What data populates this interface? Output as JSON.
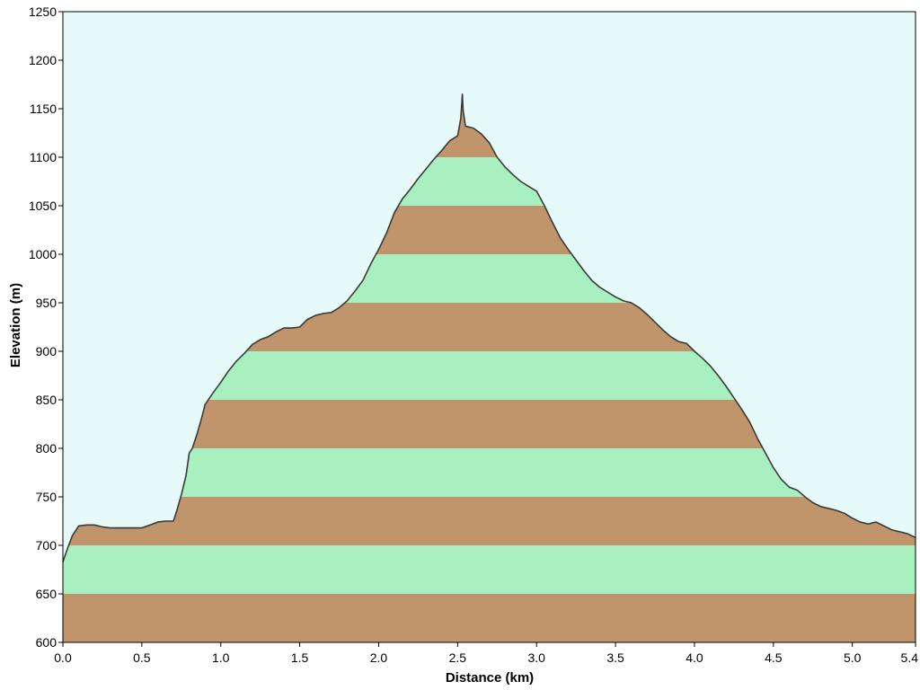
{
  "chart_data": {
    "type": "area",
    "title": "",
    "xlabel": "Distance   (km)",
    "ylabel": "Elevation (m)",
    "xlim": [
      0,
      5.4
    ],
    "ylim": [
      600,
      1250
    ],
    "grid": false,
    "legend": "none",
    "x_ticks": [
      "0.0",
      "0.5",
      "1.0",
      "1.5",
      "2.0",
      "2.5",
      "3.0",
      "3.5",
      "4.0",
      "4.5",
      "5.0",
      "5.4"
    ],
    "y_ticks": [
      "600",
      "650",
      "700",
      "750",
      "800",
      "850",
      "900",
      "950",
      "1000",
      "1050",
      "1100",
      "1150",
      "1200",
      "1250"
    ],
    "band_interval": 50,
    "colors": {
      "sky": "#e6fafa",
      "band_a": "#c1956b",
      "band_b": "#a8f0c0",
      "outline": "#3a3a3a"
    },
    "series": [
      {
        "x": [
          0.0,
          0.03,
          0.06,
          0.1,
          0.15,
          0.2,
          0.25,
          0.3,
          0.4,
          0.5,
          0.57,
          0.6,
          0.65,
          0.7,
          0.72,
          0.75,
          0.78,
          0.8,
          0.82,
          0.85,
          0.88,
          0.9,
          0.95,
          1.0,
          1.05,
          1.1,
          1.15,
          1.2,
          1.25,
          1.3,
          1.35,
          1.4,
          1.45,
          1.5,
          1.55,
          1.6,
          1.65,
          1.7,
          1.75,
          1.8,
          1.85,
          1.9,
          1.95,
          2.0,
          2.05,
          2.1,
          2.15,
          2.2,
          2.25,
          2.3,
          2.35,
          2.4,
          2.45,
          2.5,
          2.52,
          2.53,
          2.535,
          2.55,
          2.6,
          2.65,
          2.7,
          2.75,
          2.8,
          2.85,
          2.9,
          2.95,
          3.0,
          3.05,
          3.1,
          3.15,
          3.2,
          3.25,
          3.3,
          3.35,
          3.4,
          3.45,
          3.5,
          3.55,
          3.6,
          3.65,
          3.7,
          3.75,
          3.8,
          3.85,
          3.9,
          3.95,
          4.0,
          4.05,
          4.1,
          4.15,
          4.2,
          4.25,
          4.3,
          4.35,
          4.4,
          4.45,
          4.5,
          4.55,
          4.6,
          4.65,
          4.7,
          4.75,
          4.8,
          4.85,
          4.9,
          4.95,
          5.0,
          5.05,
          5.1,
          5.15,
          5.2,
          5.25,
          5.3,
          5.35,
          5.4
        ],
        "y": [
          683,
          697,
          710,
          720,
          721,
          721,
          719,
          718,
          718,
          718,
          722,
          724,
          725,
          725,
          735,
          752,
          772,
          795,
          800,
          815,
          832,
          845,
          857,
          868,
          880,
          890,
          898,
          907,
          912,
          915,
          920,
          924,
          924,
          925,
          933,
          937,
          939,
          940,
          945,
          952,
          962,
          973,
          990,
          1005,
          1022,
          1043,
          1057,
          1067,
          1078,
          1088,
          1098,
          1107,
          1117,
          1122,
          1140,
          1165,
          1148,
          1132,
          1130,
          1124,
          1115,
          1100,
          1090,
          1082,
          1075,
          1070,
          1065,
          1050,
          1033,
          1017,
          1005,
          994,
          983,
          973,
          966,
          961,
          956,
          952,
          950,
          945,
          938,
          930,
          922,
          915,
          910,
          908,
          900,
          893,
          885,
          875,
          864,
          852,
          840,
          827,
          810,
          795,
          780,
          768,
          760,
          757,
          750,
          744,
          740,
          738,
          736,
          733,
          728,
          724,
          722,
          724,
          720,
          716,
          714,
          712,
          708
        ]
      }
    ]
  }
}
